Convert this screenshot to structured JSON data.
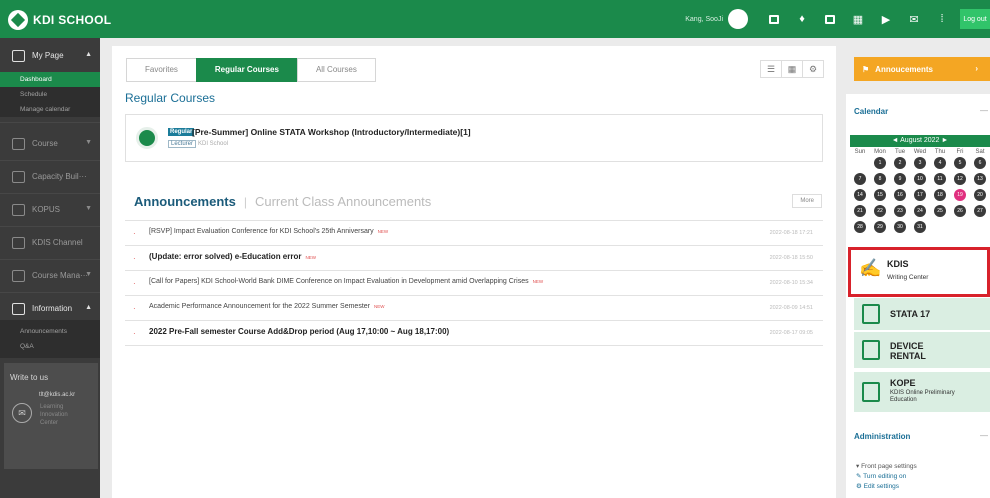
{
  "topbar": {
    "logo_text": "KDI SCHOOL",
    "logo_sub": "",
    "user_name": "Kang, SooJi",
    "logout_label": "Log out",
    "icons": [
      "calendar-icon",
      "bell-icon",
      "notice-icon",
      "book-icon",
      "video-icon",
      "mail-icon",
      "apps-grid-icon"
    ]
  },
  "sidebar": {
    "my_page": "My Page",
    "my_page_sub": [
      "Dashboard",
      "Schedule",
      "Manage calendar"
    ],
    "items": [
      {
        "label": "Course"
      },
      {
        "label": "Capacity Buil···"
      },
      {
        "label": "KOPUS"
      },
      {
        "label": "KDIS Channel"
      },
      {
        "label": "Course Mana···"
      },
      {
        "label": "Information"
      }
    ],
    "info_sub": [
      "Announcements",
      "Q&A"
    ],
    "write_to_us": "Write to us",
    "write_email": "tlt@kdis.ac.kr",
    "write_org": "Learning Innovation Center"
  },
  "main": {
    "tabs": [
      "Favorites",
      "Regular Courses",
      "All Courses"
    ],
    "section_title": "Regular Courses",
    "course": {
      "badge": "Regular",
      "name": "[Pre-Summer] Online STATA Workshop (Introductory/Intermediate)[1]",
      "lecturer_badge": "Lecturer",
      "lecturer": "KDI School"
    },
    "ann_title": "Announcements",
    "ann_title_2": "Current Class Announcements",
    "more": "More",
    "new_tag": "NEW",
    "announcements": [
      {
        "text": "[RSVP] Impact Evaluation Conference for KDI School's 25th Anniversary",
        "new": "NEW",
        "date": "2022-08-18 17:21"
      },
      {
        "text": "(Update: error solved) e-Education error",
        "new": "NEW",
        "date": "2022-08-18 15:50"
      },
      {
        "text": "[Call for Papers] KDI School-World Bank DIME Conference on Impact Evaluation in Development amid Overlapping Crises",
        "new": "NEW",
        "date": "2022-08-10 15:34"
      },
      {
        "text": "Academic Performance Announcement for the 2022 Summer Semester",
        "new": "NEW",
        "date": "2022-08-09 14:51"
      },
      {
        "text": "2022 Pre-Fall semester Course Add&Drop period (Aug 17,10:00 ~ Aug 18,17:00)",
        "new": "",
        "date": "2022-08-17 09:05"
      }
    ]
  },
  "right": {
    "announcements_btn": "Annoucements",
    "calendar_title": "Calendar",
    "cal_month": "◄   August 2022   ►",
    "weekdays": [
      "Sun",
      "Mon",
      "Tue",
      "Wed",
      "Thu",
      "Fri",
      "Sat"
    ],
    "days": [
      "1",
      "2",
      "3",
      "4",
      "5",
      "6",
      "7",
      "8",
      "9",
      "10",
      "11",
      "12",
      "13",
      "14",
      "15",
      "16",
      "17",
      "18",
      "19",
      "20",
      "21",
      "22",
      "23",
      "24",
      "25",
      "26",
      "27",
      "28",
      "29",
      "30",
      "31"
    ],
    "today": "19",
    "writing_center_name": "KDIS",
    "writing_center_sub": "Writing Center",
    "stata": "STATA 17",
    "device_1": "DEVICE",
    "device_2": "RENTAL",
    "kope_name": "KOPE",
    "kope_sub": "KDIS Online Preliminary Education",
    "admin_title": "Administration",
    "admin_items": [
      "▾ Front page settings",
      "Turn editing on",
      "Edit settings"
    ]
  }
}
